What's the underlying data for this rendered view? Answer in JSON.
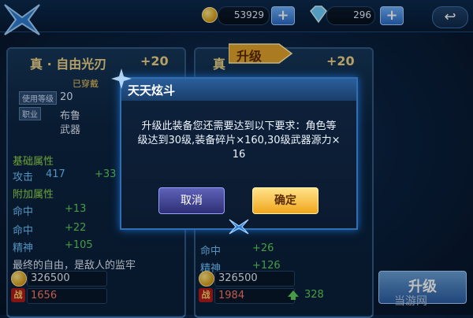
{
  "header": {
    "coins": "53929",
    "diamonds": "296",
    "plus_label": "+",
    "back_glyph": "↩"
  },
  "left_card": {
    "title": "真 · 自由光刃",
    "level": "+20",
    "status": "已穿戴",
    "use_level_label": "使用等级",
    "use_level_value": "20",
    "class_label": "职业",
    "class_value": "布鲁",
    "type_value": "武器",
    "base_attr_title": "基础属性",
    "attack_label": "攻击",
    "attack_value": "417",
    "attack_bonus": "+33",
    "extra_attr_title": "附加属性",
    "stats": [
      {
        "name": "命中",
        "value": "+13"
      },
      {
        "name": "命中",
        "value": "+22"
      },
      {
        "name": "精神",
        "value": "+105"
      }
    ],
    "description": "最终的自由，是敌人的监牢",
    "price": "326500",
    "power": "1656",
    "power_icon_label": "战"
  },
  "right_card": {
    "title": "真",
    "level": "+20",
    "stats": [
      {
        "name": "命中",
        "value": "+26"
      },
      {
        "name": "精神",
        "value": "+126"
      }
    ],
    "price": "326500",
    "power": "1984",
    "power_icon_label": "战",
    "power_increase": "328",
    "upgrade_banner": "升级"
  },
  "dialog": {
    "title": "天天炫斗",
    "message_line1": "升级此装备您还需要达到以下要求：角色等",
    "message_line2": "级达到30级,装备碎片×160,30级武器源力×",
    "message_line3": "16",
    "cancel_label": "取消",
    "confirm_label": "确定"
  },
  "bottom_button_label": "升级",
  "watermark": "当游网"
}
